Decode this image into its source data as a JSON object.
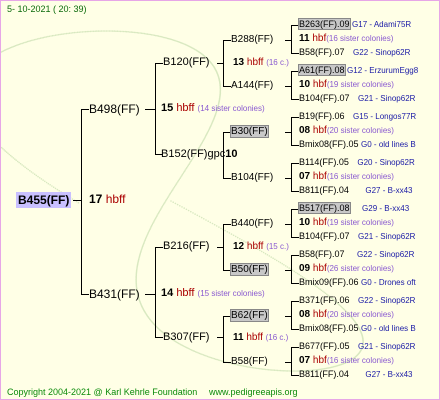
{
  "header": {
    "date": "5- 10-2021 ( 20: 39)"
  },
  "footer": {
    "copyright": "Copyright 2004-2021 @ Karl Kehrle Foundation",
    "website": "www.pedigreeapis.org"
  },
  "root": {
    "name": "B455(FF)",
    "sib_count": "17",
    "sib_label": "hbff"
  },
  "gen1": {
    "b498": {
      "name": "B498(FF)",
      "sib_count": "15",
      "sib_label": "hbff",
      "note": "(14 sister colonies)"
    },
    "b431": {
      "name": "B431(FF)",
      "sib_count": "14",
      "sib_label": "hbff",
      "note": "(15 sister colonies)"
    }
  },
  "gen2": {
    "b120": {
      "name": "B120(FF)",
      "sib_count": "13",
      "sib_label": "hbff",
      "note": "(16 c.)"
    },
    "b152": {
      "name": "B152(FF)gpc",
      "suffix": "10"
    },
    "b216": {
      "name": "B216(FF)",
      "sib_count": "12",
      "sib_label": "hbff",
      "note": "(15 c.)"
    },
    "b307": {
      "name": "B307(FF)",
      "sib_count": "11",
      "sib_label": "hbff",
      "note": "(16 c.)"
    }
  },
  "gen3": {
    "b288": {
      "name": "B288(FF)"
    },
    "a144": {
      "name": "A144(FF)"
    },
    "b30": {
      "name": "B30(FF)"
    },
    "b104a": {
      "name": "B104(FF)"
    },
    "b440": {
      "name": "B440(FF)"
    },
    "b50": {
      "name": "B50(FF)"
    },
    "b62": {
      "name": "B62(FF)"
    },
    "b58": {
      "name": "B58(FF)"
    }
  },
  "gen4": {
    "r1": {
      "name": "B263(FF).09",
      "info": "G17 - Adami75R"
    },
    "r2": {
      "count": "11",
      "label": "hbf",
      "note": "(16 sister colonies)"
    },
    "r3": {
      "name": "B58(FF).07",
      "info": "G22 - Sinop62R"
    },
    "r4": {
      "name": "A61(FF).08",
      "info": "G12 - ErzurumEgg8"
    },
    "r5": {
      "count": "10",
      "label": "hbf",
      "note": "(19 sister colonies)"
    },
    "r6": {
      "name": "B104(FF).07",
      "info": "G21 - Sinop62R"
    },
    "r7": {
      "name": "B19(FF).06",
      "info": "G15 - Longos77R"
    },
    "r8": {
      "count": "08",
      "label": "hbf",
      "note": "(20 sister colonies)"
    },
    "r9": {
      "name": "Bmix08(FF).05",
      "info": "G0 - old lines B"
    },
    "r10": {
      "name": "B114(FF).05",
      "info": "G20 - Sinop62R"
    },
    "r11": {
      "count": "07",
      "label": "hbf",
      "note": "(16 sister colonies)"
    },
    "r12": {
      "name": "B811(FF).04",
      "info": "G27 - B-xx43"
    },
    "r13": {
      "name": "B517(FF).08",
      "info": "G29 - B-xx43"
    },
    "r14": {
      "count": "10",
      "label": "hbf",
      "note": "(19 sister colonies)"
    },
    "r15": {
      "name": "B104(FF).07",
      "info": "G21 - Sinop62R"
    },
    "r16": {
      "name": "B58(FF).07",
      "info": "G22 - Sinop62R"
    },
    "r17": {
      "count": "09",
      "label": "hbf",
      "note": "(26 sister colonies)"
    },
    "r18": {
      "name": "Bmix09(FF).06",
      "info": "G0 - Drones oft"
    },
    "r19": {
      "name": "B371(FF).06",
      "info": "G22 - Sinop62R"
    },
    "r20": {
      "count": "08",
      "label": "hbf",
      "note": "(20 sister colonies)"
    },
    "r21": {
      "name": "Bmix08(FF).05",
      "info": "G0 - old lines B"
    },
    "r22": {
      "name": "B677(FF).05",
      "info": "G21 - Sinop62R"
    },
    "r23": {
      "count": "07",
      "label": "hbf",
      "note": "(16 sister colonies)"
    },
    "r24": {
      "name": "B811(FF).04",
      "info": "G27 - B-xx43"
    }
  }
}
